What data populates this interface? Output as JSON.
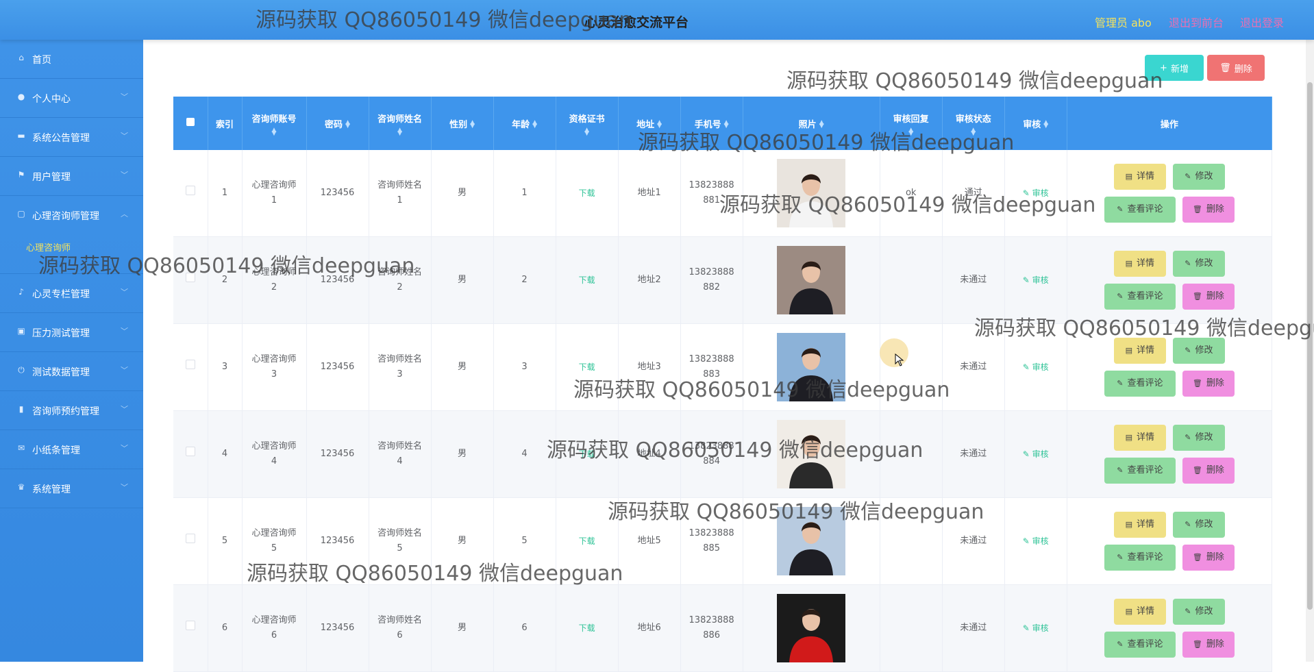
{
  "header": {
    "title": "心灵治愈交流平台",
    "admin_label": "管理员 abo",
    "back_to_front": "退出到前台",
    "logout": "退出登录"
  },
  "sidebar": {
    "items": [
      {
        "label": "首页",
        "icon": "home-icon"
      },
      {
        "label": "个人中心",
        "icon": "user-icon"
      },
      {
        "label": "系统公告管理",
        "icon": "notice-icon"
      },
      {
        "label": "用户管理",
        "icon": "flag-icon"
      },
      {
        "label": "心理咨询师管理",
        "icon": "square-icon"
      },
      {
        "label": "心灵专栏管理",
        "icon": "mic-icon"
      },
      {
        "label": "压力测试管理",
        "icon": "briefcase-icon"
      },
      {
        "label": "测试数据管理",
        "icon": "power-icon"
      },
      {
        "label": "咨询师预约管理",
        "icon": "bar-chart-icon"
      },
      {
        "label": "小纸条管理",
        "icon": "note-icon"
      },
      {
        "label": "系统管理",
        "icon": "trophy-icon"
      }
    ],
    "sub_item": "心理咨询师"
  },
  "toolbar": {
    "add_label": "新增",
    "delete_label": "删除"
  },
  "table": {
    "headers": [
      "索引",
      "咨询师账号",
      "密码",
      "咨询师姓名",
      "性别",
      "年龄",
      "资格证书",
      "地址",
      "手机号",
      "照片",
      "审核回复",
      "审核状态",
      "审核",
      "操作"
    ],
    "rows": [
      {
        "index": "1",
        "account_a": "心理咨询师",
        "account_b": "1",
        "password": "123456",
        "name_a": "咨询师姓名",
        "name_b": "1",
        "gender": "男",
        "age": "1",
        "cert": "下载",
        "address": "地址1",
        "phone_a": "13823888",
        "phone_b": "881",
        "reply": "ok",
        "status": "通过",
        "audit": "审核"
      },
      {
        "index": "2",
        "account_a": "心理咨询师",
        "account_b": "2",
        "password": "123456",
        "name_a": "咨询师姓名",
        "name_b": "2",
        "gender": "男",
        "age": "2",
        "cert": "下载",
        "address": "地址2",
        "phone_a": "13823888",
        "phone_b": "882",
        "reply": "",
        "status": "未通过",
        "audit": "审核"
      },
      {
        "index": "3",
        "account_a": "心理咨询师",
        "account_b": "3",
        "password": "123456",
        "name_a": "咨询师姓名",
        "name_b": "3",
        "gender": "男",
        "age": "3",
        "cert": "下载",
        "address": "地址3",
        "phone_a": "13823888",
        "phone_b": "883",
        "reply": "",
        "status": "未通过",
        "audit": "审核"
      },
      {
        "index": "4",
        "account_a": "心理咨询师",
        "account_b": "4",
        "password": "123456",
        "name_a": "咨询师姓名",
        "name_b": "4",
        "gender": "男",
        "age": "4",
        "cert": "下载",
        "address": "地址4",
        "phone_a": "13823888",
        "phone_b": "884",
        "reply": "",
        "status": "未通过",
        "audit": "审核"
      },
      {
        "index": "5",
        "account_a": "心理咨询师",
        "account_b": "5",
        "password": "123456",
        "name_a": "咨询师姓名",
        "name_b": "5",
        "gender": "男",
        "age": "5",
        "cert": "下载",
        "address": "地址5",
        "phone_a": "13823888",
        "phone_b": "885",
        "reply": "",
        "status": "未通过",
        "audit": "审核"
      },
      {
        "index": "6",
        "account_a": "心理咨询师",
        "account_b": "6",
        "password": "123456",
        "name_a": "咨询师姓名",
        "name_b": "6",
        "gender": "男",
        "age": "6",
        "cert": "下载",
        "address": "地址6",
        "phone_a": "13823888",
        "phone_b": "886",
        "reply": "",
        "status": "未通过",
        "audit": "审核"
      }
    ],
    "ops": {
      "detail": "详情",
      "edit": "修改",
      "comment": "查看评论",
      "delete": "删除"
    },
    "photo_colors": [
      "#e9e4de",
      "#9c8b82",
      "#8cb2d8",
      "#f0ece6",
      "#b8cbe0",
      "#1b1b1b"
    ]
  },
  "watermark": "源码获取 QQ86050149 微信deepguan"
}
